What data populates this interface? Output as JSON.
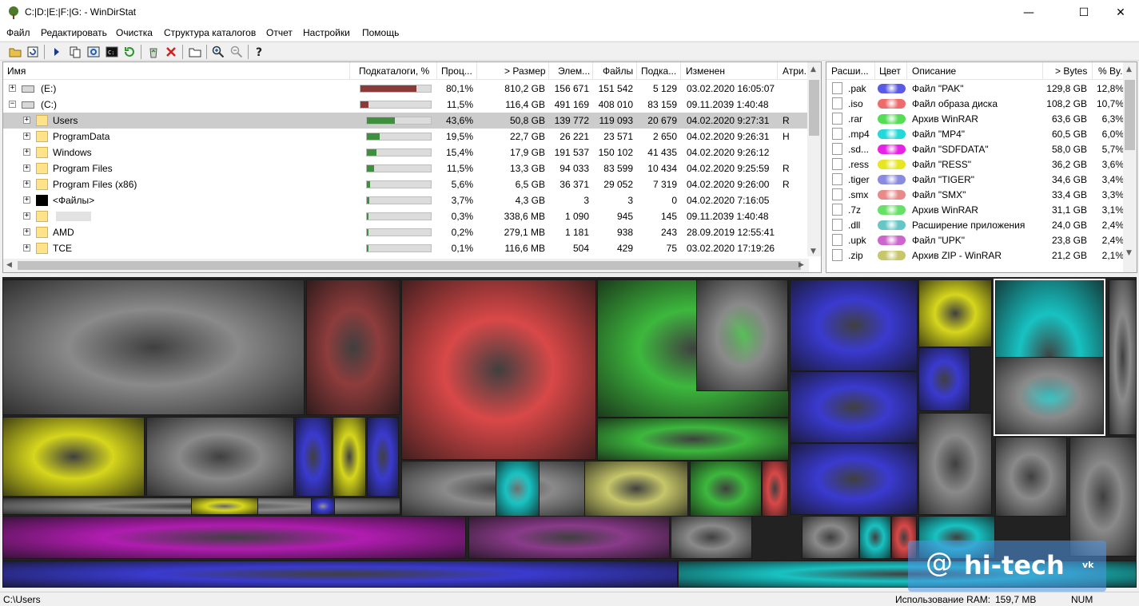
{
  "window": {
    "title": "C:|D:|E:|F:|G: - WinDirStat",
    "minimize": "—",
    "maximize": "☐",
    "close": "✕"
  },
  "menu": [
    "Файл",
    "Редактировать",
    "Очистка",
    "Структура каталогов",
    "Отчет",
    "Настройки",
    "Помощь"
  ],
  "toolbar": {
    "icons": [
      "open-icon",
      "refresh-icon",
      "expand-icon",
      "copy-path-icon",
      "explorer-icon",
      "cmd-icon",
      "refresh-selected-icon",
      "recycle-icon",
      "delete-icon",
      "new-folder-icon",
      "zoom-in-icon",
      "zoom-out-icon",
      "help-icon"
    ]
  },
  "dir_columns": [
    "Имя",
    "Подкаталоги, %",
    "Проц...",
    "> Размер",
    "Элем...",
    "Файлы",
    "Подка...",
    "Изменен",
    "Атри..."
  ],
  "dir_rows": [
    {
      "name": "(E:)",
      "pct": "80,1%",
      "fill": 0.801,
      "color": "#8b3a3a",
      "size": "810,2 GB",
      "items": "156 671",
      "files": "151 542",
      "subdirs": "5 129",
      "modified": "03.02.2020  16:05:07",
      "attr": ""
    },
    {
      "name": "(C:)",
      "pct": "11,5%",
      "fill": 0.115,
      "color": "#8b3a3a",
      "size": "116,4 GB",
      "items": "491 169",
      "files": "408 010",
      "subdirs": "83 159",
      "modified": "09.11.2039  1:40:48",
      "attr": ""
    },
    {
      "name": "Users",
      "pct": "43,6%",
      "fill": 0.436,
      "color": "#3f8f3f",
      "size": "50,8 GB",
      "items": "139 772",
      "files": "119 093",
      "subdirs": "20 679",
      "modified": "04.02.2020  9:27:31",
      "attr": "R"
    },
    {
      "name": "ProgramData",
      "pct": "19,5%",
      "fill": 0.195,
      "color": "#3f8f3f",
      "size": "22,7 GB",
      "items": "26 221",
      "files": "23 571",
      "subdirs": "2 650",
      "modified": "04.02.2020  9:26:31",
      "attr": "H"
    },
    {
      "name": "Windows",
      "pct": "15,4%",
      "fill": 0.154,
      "color": "#3f8f3f",
      "size": "17,9 GB",
      "items": "191 537",
      "files": "150 102",
      "subdirs": "41 435",
      "modified": "04.02.2020  9:26:12",
      "attr": ""
    },
    {
      "name": "Program Files",
      "pct": "11,5%",
      "fill": 0.115,
      "color": "#3f8f3f",
      "size": "13,3 GB",
      "items": "94 033",
      "files": "83 599",
      "subdirs": "10 434",
      "modified": "04.02.2020  9:25:59",
      "attr": "R"
    },
    {
      "name": "Program Files (x86)",
      "pct": "5,6%",
      "fill": 0.056,
      "color": "#3f8f3f",
      "size": "6,5 GB",
      "items": "36 371",
      "files": "29 052",
      "subdirs": "7 319",
      "modified": "04.02.2020  9:26:00",
      "attr": "R"
    },
    {
      "name": "<Файлы>",
      "pct": "3,7%",
      "fill": 0.037,
      "color": "#3f8f3f",
      "size": "4,3 GB",
      "items": "3",
      "files": "3",
      "subdirs": "0",
      "modified": "04.02.2020  7:16:05",
      "attr": ""
    },
    {
      "name": "",
      "pct": "0,3%",
      "fill": 0.003,
      "color": "#3f8f3f",
      "size": "338,6 MB",
      "items": "1 090",
      "files": "945",
      "subdirs": "145",
      "modified": "09.11.2039  1:40:48",
      "attr": ""
    },
    {
      "name": "AMD",
      "pct": "0,2%",
      "fill": 0.002,
      "color": "#3f8f3f",
      "size": "279,1 MB",
      "items": "1 181",
      "files": "938",
      "subdirs": "243",
      "modified": "28.09.2019  12:55:41",
      "attr": ""
    },
    {
      "name": "TCE",
      "pct": "0,1%",
      "fill": 0.001,
      "color": "#3f8f3f",
      "size": "116,6 MB",
      "items": "504",
      "files": "429",
      "subdirs": "75",
      "modified": "03.02.2020  17:19:26",
      "attr": ""
    }
  ],
  "ext_columns": [
    "Расши...",
    "Цвет",
    "Описание",
    "> Bytes",
    "% By..."
  ],
  "ext_rows": [
    {
      "ext": ".pak",
      "color": "#5a5ae6",
      "desc": "Файл \"PAK\"",
      "bytes": "129,8 GB",
      "pct": "12,8%"
    },
    {
      "ext": ".iso",
      "color": "#ee6b6b",
      "desc": "Файл образа диска",
      "bytes": "108,2 GB",
      "pct": "10,7%"
    },
    {
      "ext": ".rar",
      "color": "#55dd55",
      "desc": "Архив WinRAR",
      "bytes": "63,6 GB",
      "pct": "6,3%"
    },
    {
      "ext": ".mp4",
      "color": "#22d8d8",
      "desc": "Файл \"MP4\"",
      "bytes": "60,5 GB",
      "pct": "6,0%"
    },
    {
      "ext": ".sd...",
      "color": "#e622e6",
      "desc": "Файл \"SDFDATA\"",
      "bytes": "58,0 GB",
      "pct": "5,7%"
    },
    {
      "ext": ".ress",
      "color": "#e6e622",
      "desc": "Файл \"RESS\"",
      "bytes": "36,2 GB",
      "pct": "3,6%"
    },
    {
      "ext": ".tiger",
      "color": "#8a8ae0",
      "desc": "Файл \"TIGER\"",
      "bytes": "34,6 GB",
      "pct": "3,4%"
    },
    {
      "ext": ".smx",
      "color": "#e88a8a",
      "desc": "Файл \"SMX\"",
      "bytes": "33,4 GB",
      "pct": "3,3%"
    },
    {
      "ext": ".7z",
      "color": "#66e066",
      "desc": "Архив WinRAR",
      "bytes": "31,1 GB",
      "pct": "3,1%"
    },
    {
      "ext": ".dll",
      "color": "#66c6c6",
      "desc": "Расширение приложения",
      "bytes": "24,0 GB",
      "pct": "2,4%"
    },
    {
      "ext": ".upk",
      "color": "#cc66cc",
      "desc": "Файл \"UPK\"",
      "bytes": "23,8 GB",
      "pct": "2,4%"
    },
    {
      "ext": ".zip",
      "color": "#c6c66a",
      "desc": "Архив ZIP - WinRAR",
      "bytes": "21,2 GB",
      "pct": "2,1%"
    }
  ],
  "status": {
    "path": "C:\\Users",
    "ram_label": "Использование RAM:",
    "ram_value": "159,7 MB",
    "num": "NUM"
  },
  "watermark": {
    "at": "@",
    "text": "hi-tech",
    "badge": "vk"
  }
}
